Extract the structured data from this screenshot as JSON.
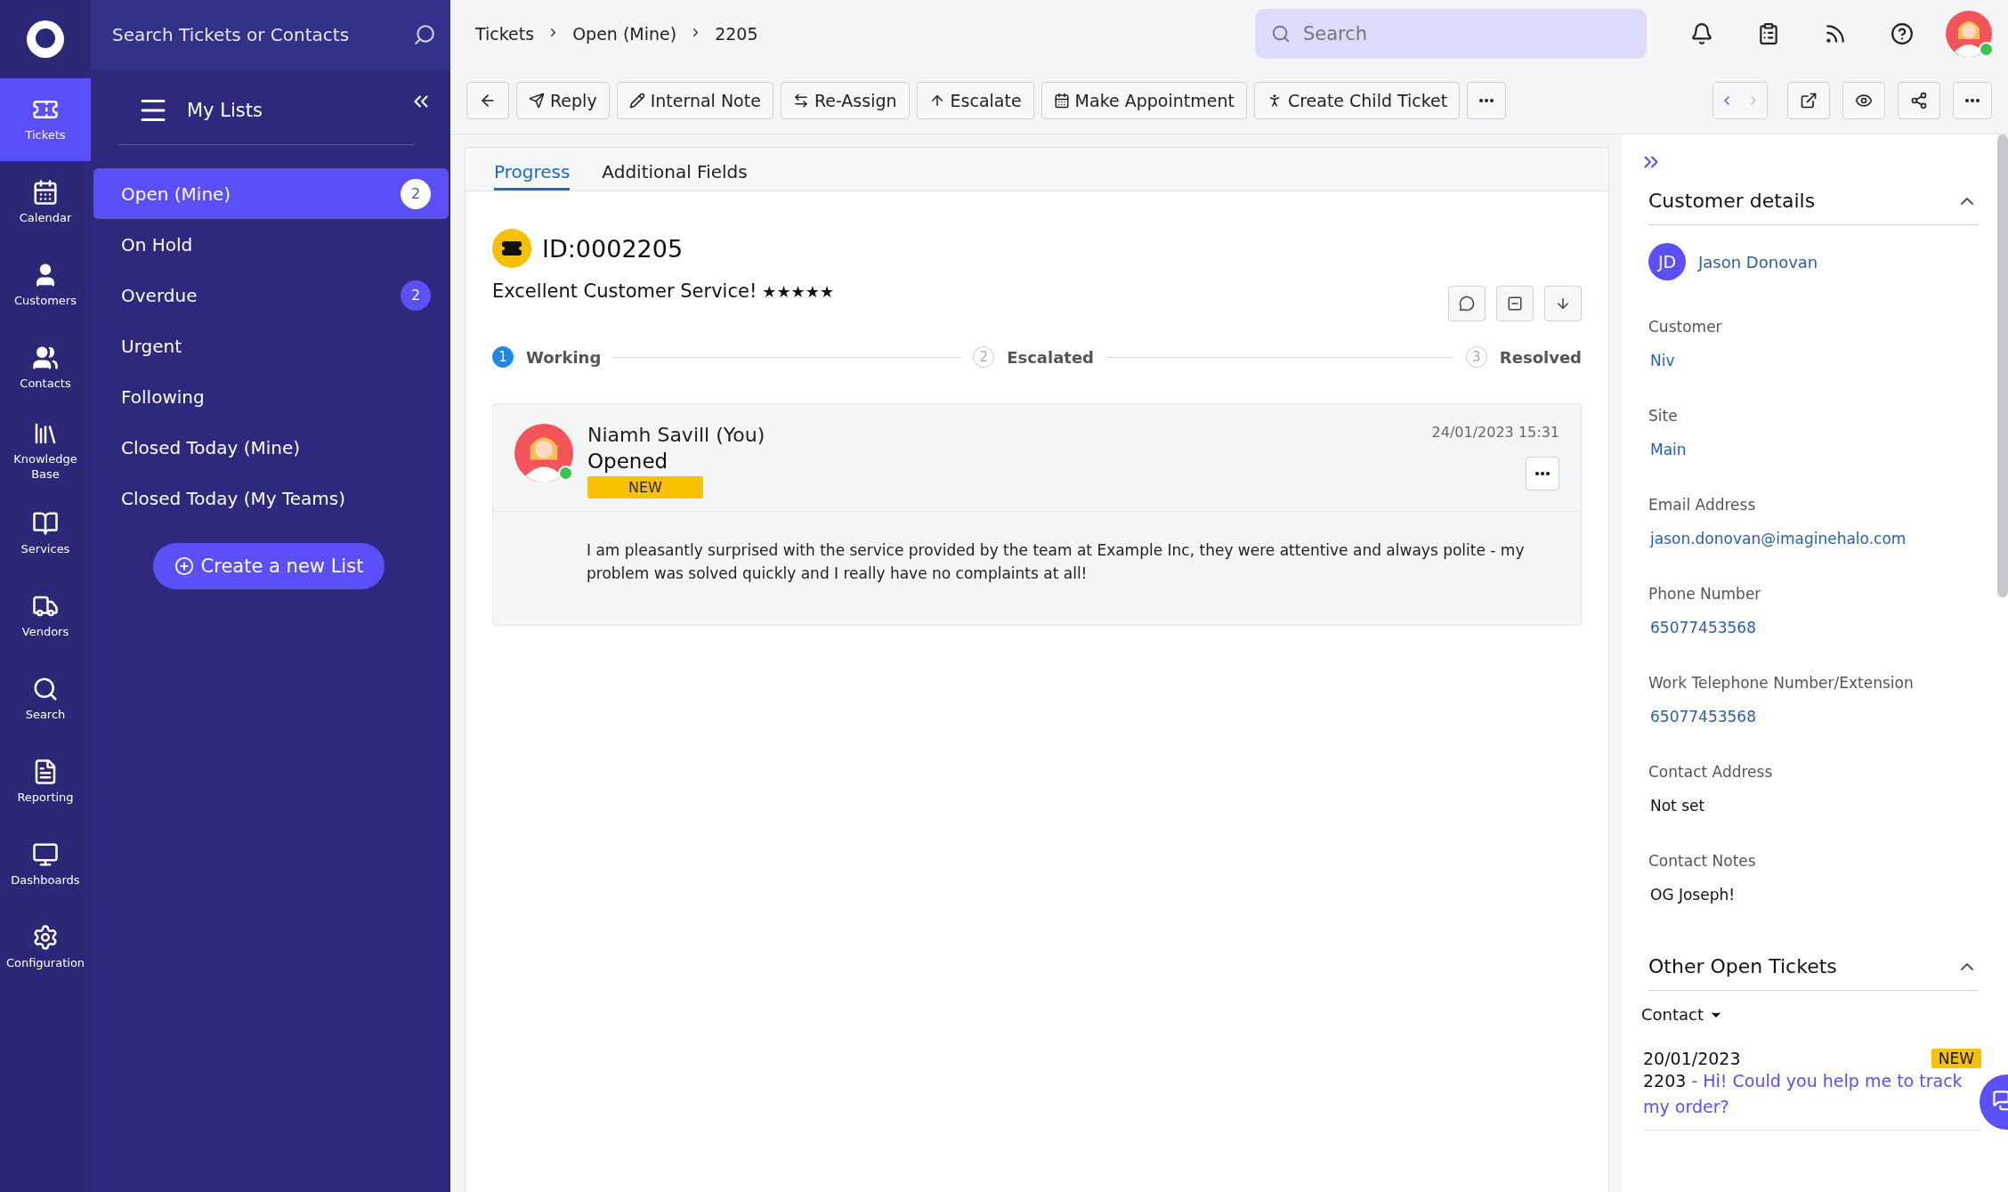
{
  "rail": [
    {
      "label": "Tickets",
      "selected": true
    },
    {
      "label": "Calendar",
      "selected": false
    },
    {
      "label": "Customers",
      "selected": false
    },
    {
      "label": "Contacts",
      "selected": false
    },
    {
      "label": "Knowledge Base",
      "selected": false
    },
    {
      "label": "Services",
      "selected": false
    },
    {
      "label": "Vendors",
      "selected": false
    },
    {
      "label": "Search",
      "selected": false
    },
    {
      "label": "Reporting",
      "selected": false
    },
    {
      "label": "Dashboards",
      "selected": false
    },
    {
      "label": "Configuration",
      "selected": false
    }
  ],
  "sidebar": {
    "search_placeholder": "Search Tickets or Contacts",
    "heading": "My Lists",
    "lists": [
      {
        "label": "Open (Mine)",
        "count": "2",
        "selected": true
      },
      {
        "label": "On Hold",
        "selected": false
      },
      {
        "label": "Overdue",
        "count": "2",
        "selected": false
      },
      {
        "label": "Urgent",
        "selected": false
      },
      {
        "label": "Following",
        "selected": false
      },
      {
        "label": "Closed Today (Mine)",
        "selected": false
      },
      {
        "label": "Closed Today (My Teams)",
        "selected": false
      }
    ],
    "create_button": "Create a new List"
  },
  "breadcrumb": [
    "Tickets",
    "Open (Mine)",
    "2205"
  ],
  "search": {
    "placeholder": "Search"
  },
  "toolbar": {
    "actions": [
      "Reply",
      "Internal Note",
      "Re-Assign",
      "Escalate",
      "Make Appointment",
      "Create Child Ticket"
    ]
  },
  "tabs": [
    {
      "label": "Progress",
      "selected": true
    },
    {
      "label": "Additional Fields",
      "selected": false
    }
  ],
  "ticket": {
    "id": "ID:0002205",
    "summary": "Excellent Customer Service!",
    "stars": 5,
    "steps": [
      {
        "number": "1",
        "label": "Working",
        "active": true
      },
      {
        "number": "2",
        "label": "Escalated",
        "active": false
      },
      {
        "number": "3",
        "label": "Resolved",
        "active": false
      }
    ],
    "action": {
      "author": "Niamh Savill (You)",
      "title": "Opened",
      "status": "NEW",
      "timestamp": "24/01/2023 15:31",
      "note": "I am pleasantly surprised with the service provided by the team at Example Inc, they were attentive and always polite - my problem was solved quickly and I really have no complaints at all!"
    }
  },
  "customer_details": {
    "title": "Customer details",
    "initials": "JD",
    "name": "Jason Donovan",
    "fields": [
      {
        "label": "Customer",
        "value": "Niv",
        "link": true
      },
      {
        "label": "Site",
        "value": "Main",
        "link": true
      },
      {
        "label": "Email Address",
        "value": "jason.donovan@imaginehalo.com",
        "link": true
      },
      {
        "label": "Phone Number",
        "value": "65077453568",
        "link": true
      },
      {
        "label": "Work Telephone Number/Extension",
        "value": "65077453568",
        "link": true
      },
      {
        "label": "Contact Address",
        "value": "Not set",
        "link": false
      },
      {
        "label": "Contact Notes",
        "value": "OG Joseph!",
        "link": false
      }
    ]
  },
  "other_open_tickets": {
    "title": "Other Open Tickets",
    "filter": "Contact",
    "tickets": [
      {
        "date": "20/01/2023",
        "status": "NEW",
        "number": "2203",
        "summary": "- Hi! Could you help me to track my order?"
      }
    ]
  }
}
